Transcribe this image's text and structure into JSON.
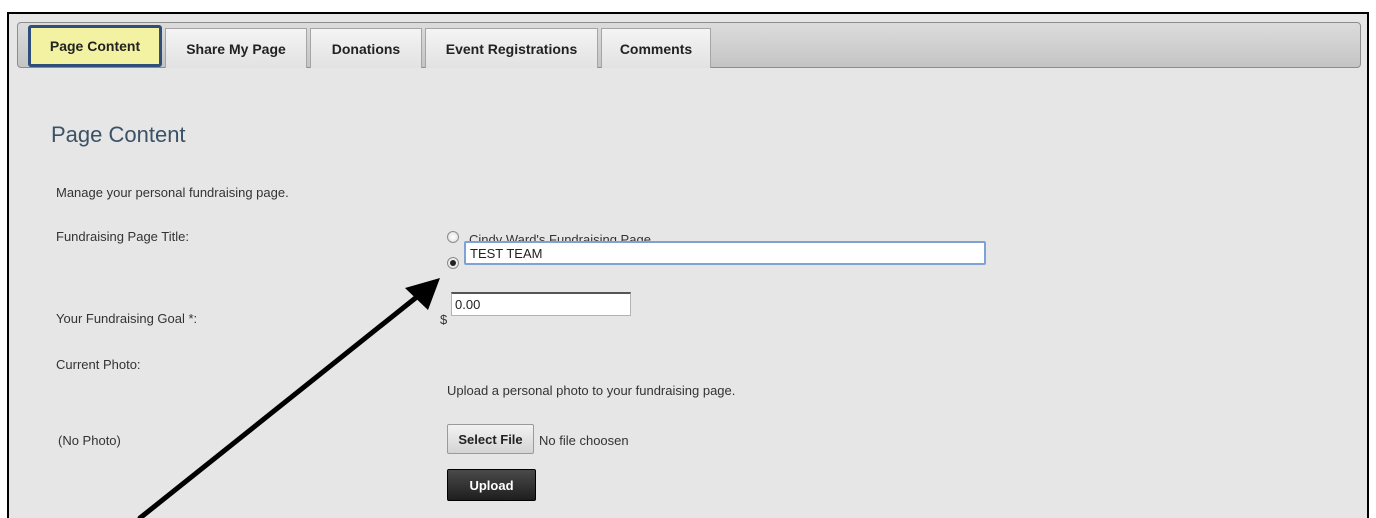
{
  "tabs": [
    {
      "label": "Page Content",
      "active": true
    },
    {
      "label": "Share My Page"
    },
    {
      "label": "Donations"
    },
    {
      "label": "Event Registrations"
    },
    {
      "label": "Comments"
    }
  ],
  "page": {
    "title": "Page Content",
    "description": "Manage your personal fundraising page.",
    "page_title_label": "Fundraising Page Title:",
    "title_options": [
      {
        "label": "Cindy Ward's Fundraising Page",
        "selected": false
      },
      {
        "value": "TEST TEAM",
        "selected": true
      }
    ],
    "goal_label": "Your Fundraising Goal *:",
    "currency_symbol": "$",
    "goal_value": "0.00",
    "photo_label": "Current Photo:",
    "upload_hint": "Upload a personal photo to your fundraising page.",
    "no_photo": "(No Photo)",
    "select_file_label": "Select File",
    "file_status": "No file choosen",
    "upload_label": "Upload"
  },
  "colors": {
    "active_tab_bg": "#f3f2a3",
    "active_tab_border": "#2f4f7a",
    "title_color": "#3b5166",
    "focus_border": "#7fa2d6",
    "upload_bg": "#2a2a2a"
  }
}
